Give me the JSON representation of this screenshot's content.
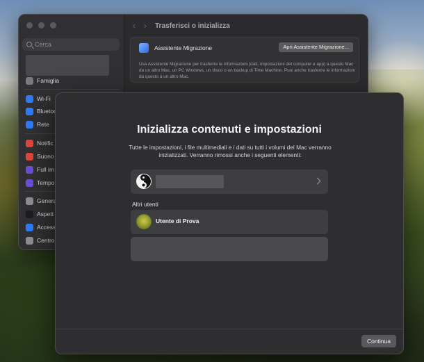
{
  "settings": {
    "search_placeholder": "Cerca",
    "toolbar_title": "Trasferisci o inizializza",
    "sidebar_items": [
      {
        "label": "Famiglia",
        "icon": "family-icon",
        "color": "#7a7a7c"
      },
      {
        "label": "Wi-Fi",
        "icon": "wifi-icon",
        "color": "#2f7bf5"
      },
      {
        "label": "Bluetoo",
        "icon": "bluetooth-icon",
        "color": "#2f7bf5"
      },
      {
        "label": "Rete",
        "icon": "network-icon",
        "color": "#2f7bf5"
      },
      {
        "label": "Notific",
        "icon": "notifications-icon",
        "color": "#e0453a"
      },
      {
        "label": "Suono",
        "icon": "sound-icon",
        "color": "#e0453a"
      },
      {
        "label": "Full im",
        "icon": "focus-icon",
        "color": "#6a4fd6"
      },
      {
        "label": "Tempo",
        "icon": "screen-time-icon",
        "color": "#6a4fd6"
      },
      {
        "label": "Genera",
        "icon": "general-icon",
        "color": "#8e8e90"
      },
      {
        "label": "Aspett",
        "icon": "appearance-icon",
        "color": "#1c1c1e"
      },
      {
        "label": "Access",
        "icon": "accessibility-icon",
        "color": "#2f7bf5"
      },
      {
        "label": "Centro",
        "icon": "control-center-icon",
        "color": "#8e8e90"
      }
    ],
    "migration": {
      "title": "Assistente Migrazione",
      "button": "Apri Assistente Migrazione...",
      "description": "Usa Assistente Migrazione per trasferire le informazioni (dati, impostazioni del computer e app) a questo Mac da un altro Mac, un PC Windows, un disco o un backup di Time Machine. Puoi anche trasferire le informazioni da questo a un altro Mac."
    }
  },
  "modal": {
    "title": "Inizializza contenuti e impostazioni",
    "description": "Tutte le impostazioni, i file multimediali e i dati su tutti i volumi del Mac verranno inizializzati. Verranno rimossi anche i seguenti elementi:",
    "other_users_label": "Altri utenti",
    "user_name": "Utente di Prova",
    "continue_button": "Continua"
  }
}
